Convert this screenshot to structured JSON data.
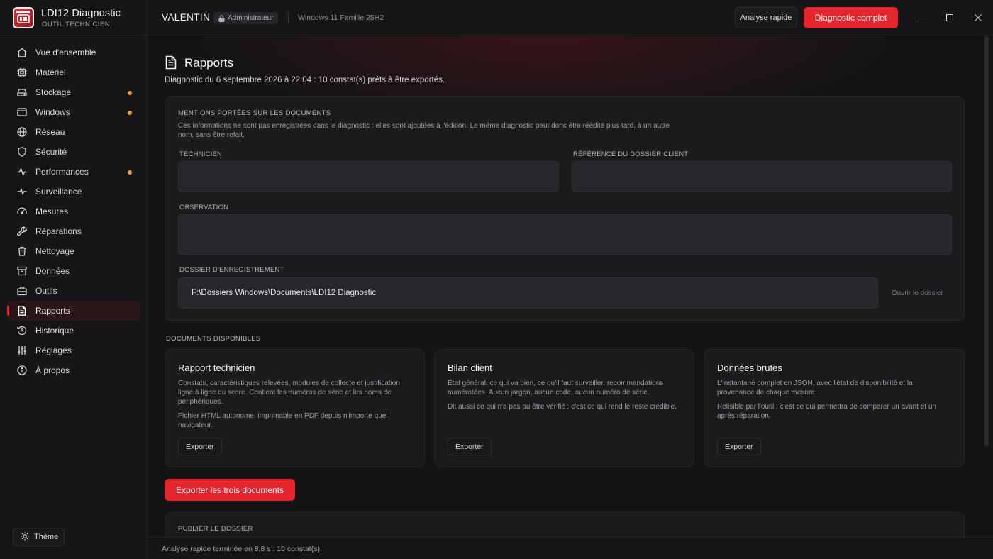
{
  "app": {
    "title": "LDI12 Diagnostic",
    "subtitle": "OUTIL TECHNICIEN",
    "accent": "#e5262f"
  },
  "sidebar": {
    "items": [
      {
        "label": "Vue d'ensemble",
        "icon": "home-icon",
        "dot": false,
        "active": false
      },
      {
        "label": "Matériel",
        "icon": "chip-icon",
        "dot": false,
        "active": false
      },
      {
        "label": "Stockage",
        "icon": "drive-icon",
        "dot": true,
        "active": false
      },
      {
        "label": "Windows",
        "icon": "window-icon",
        "dot": true,
        "active": false
      },
      {
        "label": "Réseau",
        "icon": "globe-icon",
        "dot": false,
        "active": false
      },
      {
        "label": "Sécurité",
        "icon": "shield-icon",
        "dot": false,
        "active": false
      },
      {
        "label": "Performances",
        "icon": "pulse-icon",
        "dot": true,
        "active": false
      },
      {
        "label": "Surveillance",
        "icon": "heartbeat-icon",
        "dot": false,
        "active": false
      },
      {
        "label": "Mesures",
        "icon": "gauge-icon",
        "dot": false,
        "active": false
      },
      {
        "label": "Réparations",
        "icon": "wrench-icon",
        "dot": false,
        "active": false
      },
      {
        "label": "Nettoyage",
        "icon": "trash-icon",
        "dot": false,
        "active": false
      },
      {
        "label": "Données",
        "icon": "archive-icon",
        "dot": false,
        "active": false
      },
      {
        "label": "Outils",
        "icon": "toolbox-icon",
        "dot": false,
        "active": false
      },
      {
        "label": "Rapports",
        "icon": "document-icon",
        "dot": false,
        "active": true
      },
      {
        "label": "Historique",
        "icon": "history-icon",
        "dot": false,
        "active": false
      },
      {
        "label": "Réglages",
        "icon": "sliders-icon",
        "dot": false,
        "active": false
      },
      {
        "label": "À propos",
        "icon": "info-icon",
        "dot": false,
        "active": false
      }
    ],
    "theme_label": "Thème",
    "dot_color": "#f59a3a"
  },
  "topbar": {
    "user": "VALENTIN",
    "role": "Administrateur",
    "os": "Windows 11 Famille 25H2",
    "quick_label": "Analyse rapide",
    "full_label": "Diagnostic complet"
  },
  "page": {
    "title": "Rapports",
    "subtitle": "Diagnostic du 6 septembre 2026 à 22:04 : 10 constat(s) prêts à être exportés."
  },
  "mentions": {
    "heading": "MENTIONS PORTÉES SUR LES DOCUMENTS",
    "help_line1": "Ces informations ne sont pas enregistrées dans le diagnostic : elles sont ajoutées à l'édition. Le même diagnostic peut donc être réédité plus tard, à un autre",
    "help_line2": "nom, sans être refait.",
    "technician_label": "TECHNICIEN",
    "technician_value": "",
    "reference_label": "RÉFÉRENCE DU DOSSIER CLIENT",
    "reference_value": "",
    "observation_label": "OBSERVATION",
    "observation_value": "",
    "folder_label": "DOSSIER D'ENREGISTREMENT",
    "folder_value": "F:\\Dossiers Windows\\Documents\\LDI12 Diagnostic",
    "open_folder_label": "Ouvrir le dossier"
  },
  "documents": {
    "heading": "DOCUMENTS DISPONIBLES",
    "cards": [
      {
        "title": "Rapport technicien",
        "p1_l1": "Constats, caractéristiques relevées, modules de collecte et justification",
        "p1_l2": "ligne à ligne du score. Contient les numéros de série et les noms de",
        "p1_l3": "périphériques.",
        "p2_l1": "Fichier HTML autonome, imprimable en PDF depuis n'importe quel",
        "p2_l2": "navigateur.",
        "button": "Exporter"
      },
      {
        "title": "Bilan client",
        "p1_l1": "État général, ce qui va bien, ce qu'il faut surveiller, recommandations",
        "p1_l2": "numérotées. Aucun jargon, aucun code, aucun numéro de série.",
        "p2_l1": "Dit aussi ce qui n'a pas pu être vérifié : c'est ce qui rend le reste crédible.",
        "button": "Exporter"
      },
      {
        "title": "Données brutes",
        "p1_l1": "L'instantané complet en JSON, avec l'état de disponibilité et la",
        "p1_l2": "provenance de chaque mesure.",
        "p2_l1": "Relisible par l'outil : c'est ce qui permettra de comparer un avant et un",
        "p2_l2": "après réparation.",
        "button": "Exporter"
      }
    ],
    "export_all_label": "Exporter les trois documents"
  },
  "publish": {
    "heading": "PUBLIER LE DOSSIER"
  },
  "status": {
    "text": "Analyse rapide terminée en 8,8 s : 10 constat(s)."
  }
}
